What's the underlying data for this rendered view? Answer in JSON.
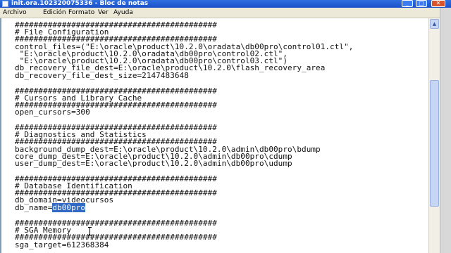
{
  "window": {
    "title": "init.ora.102320075336 - Bloc de notas",
    "minimize_glyph": "_",
    "maximize_glyph": "□",
    "close_glyph": "✕"
  },
  "menu": {
    "items": [
      "Archivo",
      "Edición",
      "Formato",
      "Ver",
      "Ayuda"
    ]
  },
  "scrollbar": {
    "up_arrow": "▲"
  },
  "editor": {
    "lines": [
      "###########################################",
      "# File Configuration",
      "###########################################",
      "control_files=(\"E:\\oracle\\product\\10.2.0\\oradata\\db00pro\\control01.ctl\",",
      " \"E:\\oracle\\product\\10.2.0\\oradata\\db00pro\\control02.ctl\",",
      " \"E:\\oracle\\product\\10.2.0\\oradata\\db00pro\\control03.ctl\")",
      "db_recovery_file_dest=E:\\oracle\\product\\10.2.0\\flash_recovery_area",
      "db_recovery_file_dest_size=2147483648",
      "",
      "###########################################",
      "# Cursors and Library Cache",
      "###########################################",
      "open_cursors=300",
      "",
      "###########################################",
      "# Diagnostics and Statistics",
      "###########################################",
      "background_dump_dest=E:\\oracle\\product\\10.2.0\\admin\\db00pro\\bdump",
      "core_dump_dest=E:\\oracle\\product\\10.2.0\\admin\\db00pro\\cdump",
      "user_dump_dest=E:\\oracle\\product\\10.2.0\\admin\\db00pro\\udump",
      "",
      "###########################################",
      "# Database Identification",
      "###########################################",
      "db_domain=videocursos",
      "db_name=",
      "",
      "###########################################",
      "# SGA Memory",
      "###########################################",
      "sga_target=612368384"
    ],
    "selected_text": "db00pro"
  }
}
